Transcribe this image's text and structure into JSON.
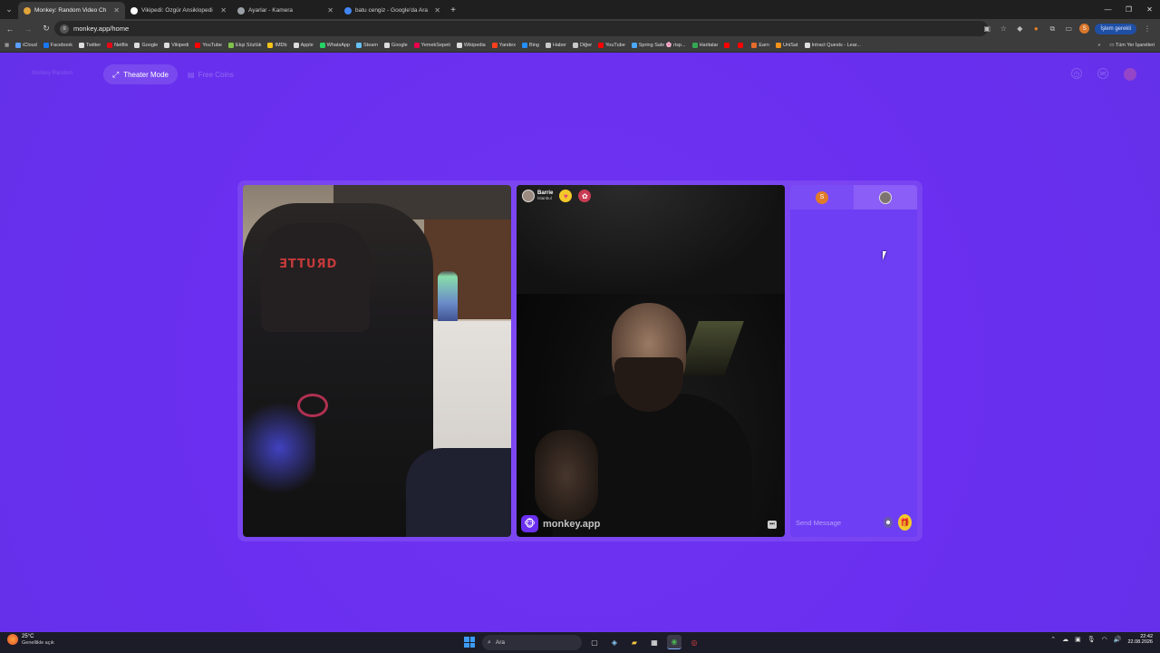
{
  "browser": {
    "tabs": [
      {
        "title": "Monkey: Random Video Ch",
        "fav_color": "#e0a43a",
        "active": true
      },
      {
        "title": "Vikipedi: Özgür Ansiklopedi",
        "fav_color": "#ffffff",
        "active": false
      },
      {
        "title": "Ayarlar - Kamera",
        "fav_color": "#9aa0a6",
        "active": false
      },
      {
        "title": "batu cengiz - Google'da Ara",
        "fav_color": "#4285f4",
        "active": false
      }
    ],
    "url": "monkey.app/home",
    "update_label": "İşlem gerekli",
    "profile_initial": "S",
    "bookmarks": [
      {
        "label": "iCloud",
        "color": "#5aa0ff"
      },
      {
        "label": "Facebook",
        "color": "#1877f2"
      },
      {
        "label": "Twitter",
        "color": "#dddddd"
      },
      {
        "label": "Netflix",
        "color": "#e50914"
      },
      {
        "label": "Google",
        "color": "#dddddd"
      },
      {
        "label": "Vikipedi",
        "color": "#dddddd"
      },
      {
        "label": "YouTube",
        "color": "#ff0000"
      },
      {
        "label": "Ekşi Sözlük",
        "color": "#81c14b"
      },
      {
        "label": "IMDb",
        "color": "#f5c518"
      },
      {
        "label": "Apple",
        "color": "#dddddd"
      },
      {
        "label": "WhatsApp",
        "color": "#25d366"
      },
      {
        "label": "Steam",
        "color": "#66c0f4"
      },
      {
        "label": "Google",
        "color": "#dddddd"
      },
      {
        "label": "YemekSepeti",
        "color": "#ea004b"
      },
      {
        "label": "Wikipedia",
        "color": "#dddddd"
      },
      {
        "label": "Yandex",
        "color": "#fc3f1d"
      },
      {
        "label": "Bing",
        "color": "#258ffa"
      },
      {
        "label": "Haber",
        "color": "#c9c9c9"
      },
      {
        "label": "Diğer",
        "color": "#c9c9c9"
      },
      {
        "label": "YouTube",
        "color": "#ff0000"
      },
      {
        "label": "Spring Sale 🌸 risp...",
        "color": "#4aa8ff"
      },
      {
        "label": "Haritalar",
        "color": "#34a853"
      },
      {
        "label": "",
        "color": "#ff0000"
      },
      {
        "label": "",
        "color": "#ff0000"
      },
      {
        "label": "Earn",
        "color": "#e66c2c"
      },
      {
        "label": "UniSat",
        "color": "#f7931a"
      },
      {
        "label": "Intract Quests - Lear...",
        "color": "#dddddd"
      }
    ],
    "all_bookmarks": "Tüm Yer İşaretleri"
  },
  "app": {
    "brand": "Monkey Random",
    "theater_mode": "Theater Mode",
    "free_coins": "Free Coins",
    "peer": {
      "name": "Barrie",
      "location": "İstanbul"
    },
    "local_overlay_text": "ƎTTUЯD",
    "watermark": "monkey.app",
    "chat": {
      "me_initial": "S",
      "placeholder": "Send Message"
    }
  },
  "taskbar": {
    "temperature": "25°C",
    "condition": "Genellikle açık",
    "search_placeholder": "Ara",
    "time": "22:42",
    "date": "22.08.2026"
  }
}
